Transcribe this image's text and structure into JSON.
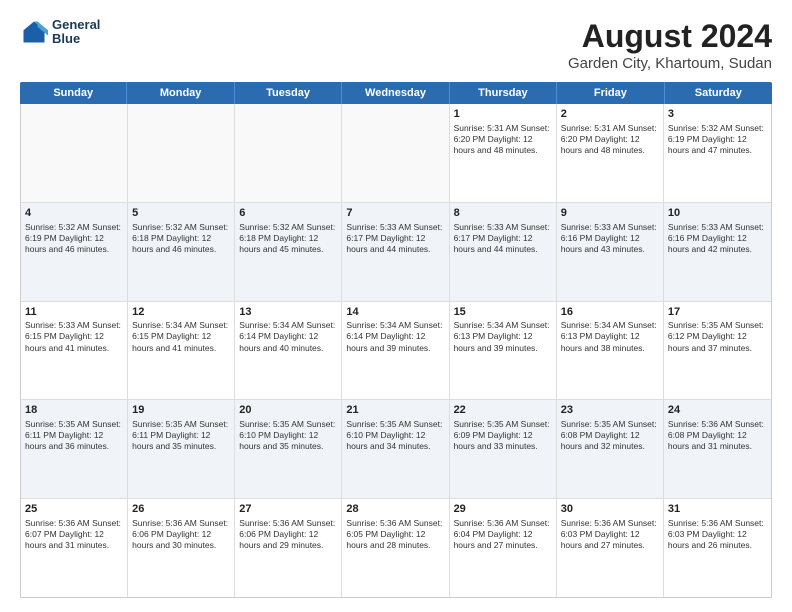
{
  "header": {
    "logo_line1": "General",
    "logo_line2": "Blue",
    "title": "August 2024",
    "subtitle": "Garden City, Khartoum, Sudan"
  },
  "weekdays": [
    "Sunday",
    "Monday",
    "Tuesday",
    "Wednesday",
    "Thursday",
    "Friday",
    "Saturday"
  ],
  "rows": [
    [
      {
        "day": "",
        "text": "",
        "empty": true
      },
      {
        "day": "",
        "text": "",
        "empty": true
      },
      {
        "day": "",
        "text": "",
        "empty": true
      },
      {
        "day": "",
        "text": "",
        "empty": true
      },
      {
        "day": "1",
        "text": "Sunrise: 5:31 AM\nSunset: 6:20 PM\nDaylight: 12 hours\nand 48 minutes."
      },
      {
        "day": "2",
        "text": "Sunrise: 5:31 AM\nSunset: 6:20 PM\nDaylight: 12 hours\nand 48 minutes."
      },
      {
        "day": "3",
        "text": "Sunrise: 5:32 AM\nSunset: 6:19 PM\nDaylight: 12 hours\nand 47 minutes."
      }
    ],
    [
      {
        "day": "4",
        "text": "Sunrise: 5:32 AM\nSunset: 6:19 PM\nDaylight: 12 hours\nand 46 minutes."
      },
      {
        "day": "5",
        "text": "Sunrise: 5:32 AM\nSunset: 6:18 PM\nDaylight: 12 hours\nand 46 minutes."
      },
      {
        "day": "6",
        "text": "Sunrise: 5:32 AM\nSunset: 6:18 PM\nDaylight: 12 hours\nand 45 minutes."
      },
      {
        "day": "7",
        "text": "Sunrise: 5:33 AM\nSunset: 6:17 PM\nDaylight: 12 hours\nand 44 minutes."
      },
      {
        "day": "8",
        "text": "Sunrise: 5:33 AM\nSunset: 6:17 PM\nDaylight: 12 hours\nand 44 minutes."
      },
      {
        "day": "9",
        "text": "Sunrise: 5:33 AM\nSunset: 6:16 PM\nDaylight: 12 hours\nand 43 minutes."
      },
      {
        "day": "10",
        "text": "Sunrise: 5:33 AM\nSunset: 6:16 PM\nDaylight: 12 hours\nand 42 minutes."
      }
    ],
    [
      {
        "day": "11",
        "text": "Sunrise: 5:33 AM\nSunset: 6:15 PM\nDaylight: 12 hours\nand 41 minutes."
      },
      {
        "day": "12",
        "text": "Sunrise: 5:34 AM\nSunset: 6:15 PM\nDaylight: 12 hours\nand 41 minutes."
      },
      {
        "day": "13",
        "text": "Sunrise: 5:34 AM\nSunset: 6:14 PM\nDaylight: 12 hours\nand 40 minutes."
      },
      {
        "day": "14",
        "text": "Sunrise: 5:34 AM\nSunset: 6:14 PM\nDaylight: 12 hours\nand 39 minutes."
      },
      {
        "day": "15",
        "text": "Sunrise: 5:34 AM\nSunset: 6:13 PM\nDaylight: 12 hours\nand 39 minutes."
      },
      {
        "day": "16",
        "text": "Sunrise: 5:34 AM\nSunset: 6:13 PM\nDaylight: 12 hours\nand 38 minutes."
      },
      {
        "day": "17",
        "text": "Sunrise: 5:35 AM\nSunset: 6:12 PM\nDaylight: 12 hours\nand 37 minutes."
      }
    ],
    [
      {
        "day": "18",
        "text": "Sunrise: 5:35 AM\nSunset: 6:11 PM\nDaylight: 12 hours\nand 36 minutes."
      },
      {
        "day": "19",
        "text": "Sunrise: 5:35 AM\nSunset: 6:11 PM\nDaylight: 12 hours\nand 35 minutes."
      },
      {
        "day": "20",
        "text": "Sunrise: 5:35 AM\nSunset: 6:10 PM\nDaylight: 12 hours\nand 35 minutes."
      },
      {
        "day": "21",
        "text": "Sunrise: 5:35 AM\nSunset: 6:10 PM\nDaylight: 12 hours\nand 34 minutes."
      },
      {
        "day": "22",
        "text": "Sunrise: 5:35 AM\nSunset: 6:09 PM\nDaylight: 12 hours\nand 33 minutes."
      },
      {
        "day": "23",
        "text": "Sunrise: 5:35 AM\nSunset: 6:08 PM\nDaylight: 12 hours\nand 32 minutes."
      },
      {
        "day": "24",
        "text": "Sunrise: 5:36 AM\nSunset: 6:08 PM\nDaylight: 12 hours\nand 31 minutes."
      }
    ],
    [
      {
        "day": "25",
        "text": "Sunrise: 5:36 AM\nSunset: 6:07 PM\nDaylight: 12 hours\nand 31 minutes."
      },
      {
        "day": "26",
        "text": "Sunrise: 5:36 AM\nSunset: 6:06 PM\nDaylight: 12 hours\nand 30 minutes."
      },
      {
        "day": "27",
        "text": "Sunrise: 5:36 AM\nSunset: 6:06 PM\nDaylight: 12 hours\nand 29 minutes."
      },
      {
        "day": "28",
        "text": "Sunrise: 5:36 AM\nSunset: 6:05 PM\nDaylight: 12 hours\nand 28 minutes."
      },
      {
        "day": "29",
        "text": "Sunrise: 5:36 AM\nSunset: 6:04 PM\nDaylight: 12 hours\nand 27 minutes."
      },
      {
        "day": "30",
        "text": "Sunrise: 5:36 AM\nSunset: 6:03 PM\nDaylight: 12 hours\nand 27 minutes."
      },
      {
        "day": "31",
        "text": "Sunrise: 5:36 AM\nSunset: 6:03 PM\nDaylight: 12 hours\nand 26 minutes."
      }
    ]
  ]
}
